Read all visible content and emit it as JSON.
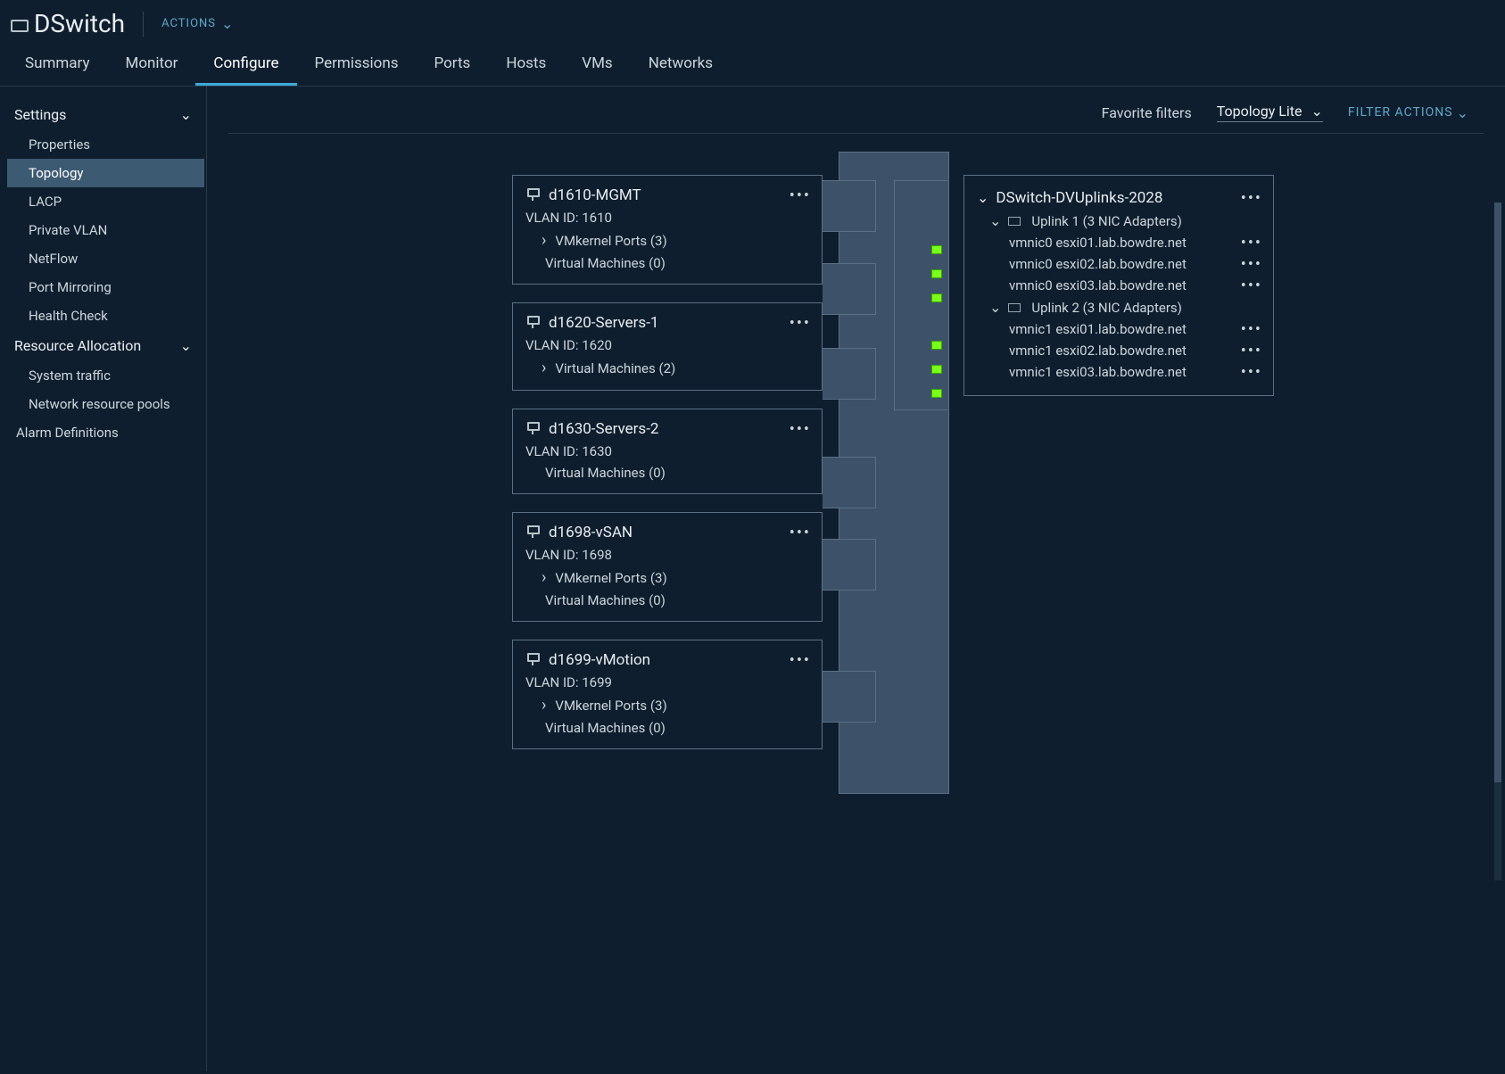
{
  "header": {
    "title": "DSwitch",
    "actions": "ACTIONS"
  },
  "tabs": [
    "Summary",
    "Monitor",
    "Configure",
    "Permissions",
    "Ports",
    "Hosts",
    "VMs",
    "Networks"
  ],
  "active_tab": "Configure",
  "sidebar": {
    "groups": [
      {
        "label": "Settings",
        "items": [
          "Properties",
          "Topology",
          "LACP",
          "Private VLAN",
          "NetFlow",
          "Port Mirroring",
          "Health Check"
        ],
        "active": "Topology"
      },
      {
        "label": "Resource Allocation",
        "items": [
          "System traffic",
          "Network resource pools"
        ]
      }
    ],
    "alarm": "Alarm Definitions"
  },
  "filters": {
    "favorite": "Favorite filters",
    "selected": "Topology Lite",
    "actions": "FILTER ACTIONS"
  },
  "portgroups": [
    {
      "name": "d1610-MGMT",
      "vlan": "VLAN ID: 1610",
      "lines": [
        {
          "t": "VMkernel Ports (3)",
          "exp": true
        },
        {
          "t": "Virtual Machines (0)",
          "exp": false
        }
      ]
    },
    {
      "name": "d1620-Servers-1",
      "vlan": "VLAN ID: 1620",
      "lines": [
        {
          "t": "Virtual Machines (2)",
          "exp": true
        }
      ]
    },
    {
      "name": "d1630-Servers-2",
      "vlan": "VLAN ID: 1630",
      "lines": [
        {
          "t": "Virtual Machines (0)",
          "exp": false
        }
      ]
    },
    {
      "name": "d1698-vSAN",
      "vlan": "VLAN ID: 1698",
      "lines": [
        {
          "t": "VMkernel Ports (3)",
          "exp": true
        },
        {
          "t": "Virtual Machines (0)",
          "exp": false
        }
      ]
    },
    {
      "name": "d1699-vMotion",
      "vlan": "VLAN ID: 1699",
      "lines": [
        {
          "t": "VMkernel Ports (3)",
          "exp": true
        },
        {
          "t": "Virtual Machines (0)",
          "exp": false
        }
      ]
    }
  ],
  "uplinks": {
    "title": "DSwitch-DVUplinks-2028",
    "groups": [
      {
        "label": "Uplink 1 (3 NIC Adapters)",
        "nics": [
          "vmnic0 esxi01.lab.bowdre.net",
          "vmnic0 esxi02.lab.bowdre.net",
          "vmnic0 esxi03.lab.bowdre.net"
        ]
      },
      {
        "label": "Uplink 2 (3 NIC Adapters)",
        "nics": [
          "vmnic1 esxi01.lab.bowdre.net",
          "vmnic1 esxi02.lab.bowdre.net",
          "vmnic1 esxi03.lab.bowdre.net"
        ]
      }
    ]
  }
}
